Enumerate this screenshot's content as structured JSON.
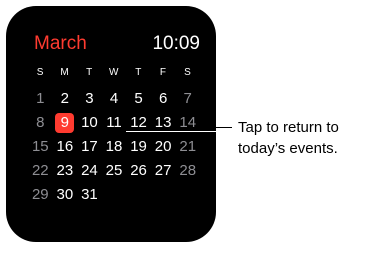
{
  "header": {
    "month": "March",
    "time": "10:09"
  },
  "weekdays": [
    "S",
    "M",
    "T",
    "W",
    "T",
    "F",
    "S"
  ],
  "weeks": [
    [
      "1",
      "2",
      "3",
      "4",
      "5",
      "6",
      "7"
    ],
    [
      "8",
      "9",
      "10",
      "11",
      "12",
      "13",
      "14"
    ],
    [
      "15",
      "16",
      "17",
      "18",
      "19",
      "20",
      "21"
    ],
    [
      "22",
      "23",
      "24",
      "25",
      "26",
      "27",
      "28"
    ],
    [
      "29",
      "30",
      "31",
      "",
      "",
      "",
      ""
    ]
  ],
  "today": "9",
  "callout": {
    "line1": "Tap to return to",
    "line2": "today’s events."
  },
  "colors": {
    "accent": "#ff3b30",
    "weekend": "#8e8e93",
    "background": "#000000"
  }
}
